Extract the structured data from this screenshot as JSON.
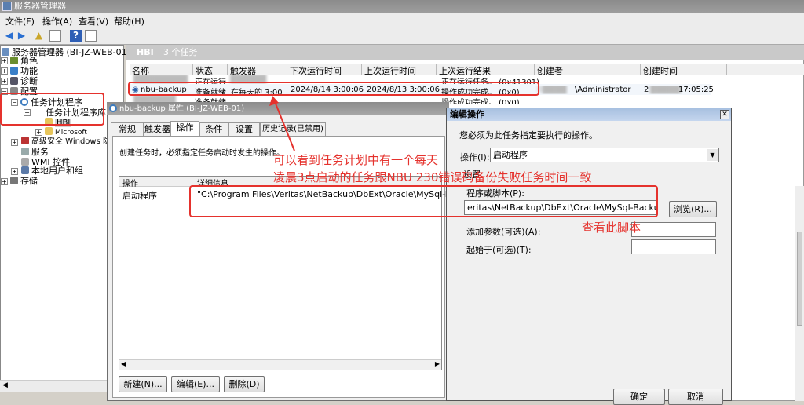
{
  "window": {
    "title": "服务器管理器"
  },
  "menu": [
    "文件(F)",
    "操作(A)",
    "查看(V)",
    "帮助(H)"
  ],
  "tree": {
    "root": "服务器管理器 (BI-JZ-WEB-01)",
    "roles": "角色",
    "features": "功能",
    "diagnostics": "诊断",
    "config": "配置",
    "task_scheduler": "任务计划程序",
    "task_library": "任务计划程序库",
    "hbi": "HBI",
    "microsoft": "Microsoft",
    "firewall": "高级安全 Windows 防",
    "services": "服务",
    "wmi": "WMI 控件",
    "local_users": "本地用户和组",
    "storage": "存储"
  },
  "main": {
    "header_name": "HBI",
    "header_count": "3 个任务",
    "columns": [
      "名称",
      "状态",
      "触发器",
      "下次运行时间",
      "上次运行时间",
      "上次运行结果",
      "创建者",
      "创建时间"
    ],
    "row1": {
      "status": "正在运行",
      "result": "正在运行任务。 (0x41301)"
    },
    "row2": {
      "name": "nbu-backup",
      "status": "准备就绪",
      "trigger": "在每天的 3:00",
      "next_run": "2024/8/14 3:00:06",
      "last_run": "2024/8/13 3:00:06",
      "result": "操作成功完成。 (0x0)",
      "creator": "\\Administrator",
      "created": "2",
      "created_time": "17:05:25"
    },
    "row3": {
      "status": "准备就绪",
      "result": "操作成功完成。 (0x0)"
    }
  },
  "properties": {
    "title": "nbu-backup 属性 (BI-JZ-WEB-01)",
    "tabs": [
      "常规",
      "触发器",
      "操作",
      "条件",
      "设置",
      "历史记录(已禁用)"
    ],
    "description": "创建任务时，必须指定任务启动时发生的操作。",
    "list_headers": [
      "操作",
      "详细信息"
    ],
    "action": "启动程序",
    "details": "\"C:\\Program Files\\Veritas\\NetBackup\\DbExt\\Oracle\\MySql-Backup.",
    "buttons": [
      "新建(N)...",
      "编辑(E)...",
      "删除(D)"
    ]
  },
  "edit_dialog": {
    "title": "编辑操作",
    "description": "您必须为此任务指定要执行的操作。",
    "action_label": "操作(I):",
    "action_value": "启动程序",
    "settings_label": "设置",
    "program_label": "程序或脚本(P):",
    "program_value": "eritas\\NetBackup\\DbExt\\Oracle\\MySql-Backup.cmd\"",
    "browse": "浏览(R)...",
    "args_label": "添加参数(可选)(A):",
    "start_label": "起始于(可选)(T):",
    "ok": "确定",
    "cancel": "取消"
  },
  "annotations": {
    "line1": "可以看到任务计划中有一个每天",
    "line2": "凌晨3点启动的任务跟NBU 230错误码备份失败任务时间一致",
    "script": "查看此脚本"
  },
  "colors": {
    "annotation": "#e5322d",
    "selection": "#f2f6fb"
  }
}
